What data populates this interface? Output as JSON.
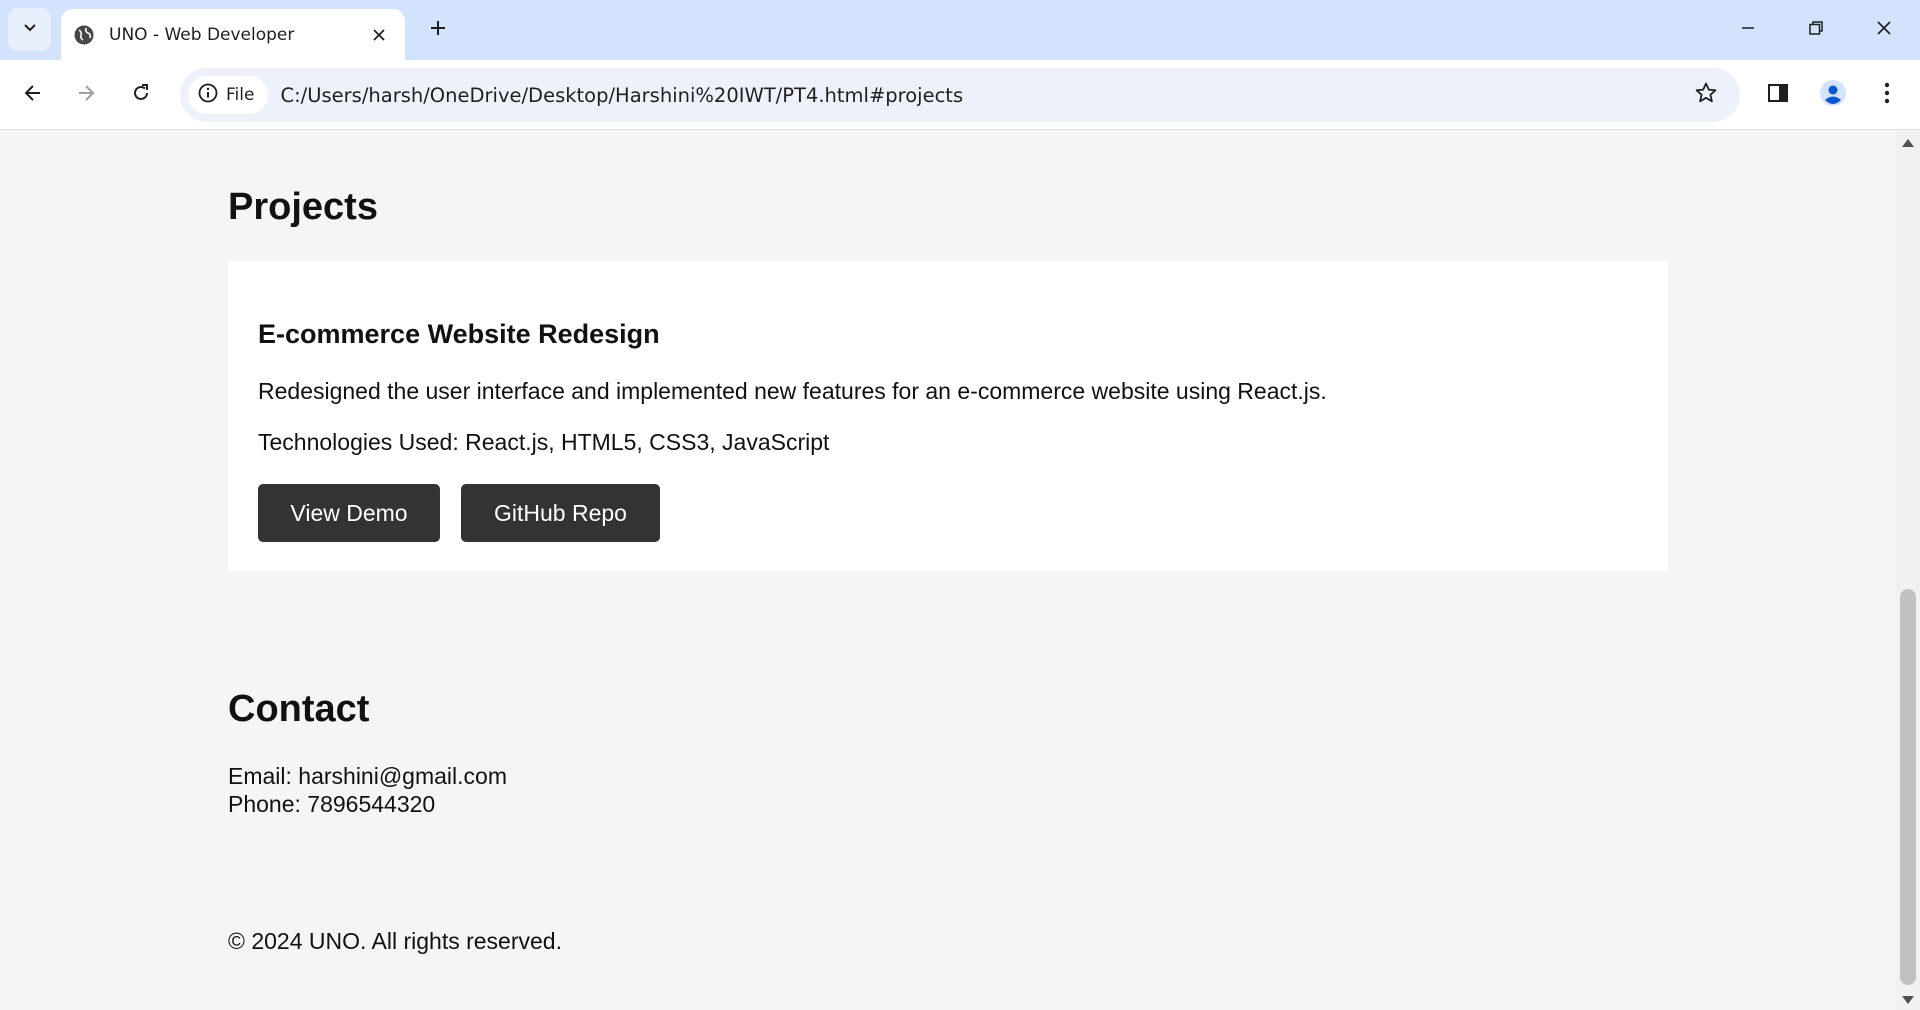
{
  "browser": {
    "tab_title": "UNO - Web Developer",
    "new_tab_icon": "plus-icon",
    "omnibox": {
      "chip_label": "File",
      "url": "C:/Users/harsh/OneDrive/Desktop/Harshini%20IWT/PT4.html#projects"
    }
  },
  "page": {
    "projects": {
      "heading": "Projects",
      "items": [
        {
          "title": "E-commerce Website Redesign",
          "description": "Redesigned the user interface and implemented new features for an e-commerce website using React.js.",
          "technologies": "Technologies Used: React.js, HTML5, CSS3, JavaScript",
          "demo_label": "View Demo",
          "repo_label": "GitHub Repo"
        }
      ]
    },
    "contact": {
      "heading": "Contact",
      "email": "Email: harshini@gmail.com",
      "phone": "Phone: 7896544320"
    },
    "footer": "© 2024 UNO. All rights reserved."
  },
  "colors": {
    "tabstrip_bg": "#d3e3fd",
    "page_bg": "#f5f5f5",
    "button_bg": "#333333",
    "profile_accent": "#0b57d0"
  }
}
